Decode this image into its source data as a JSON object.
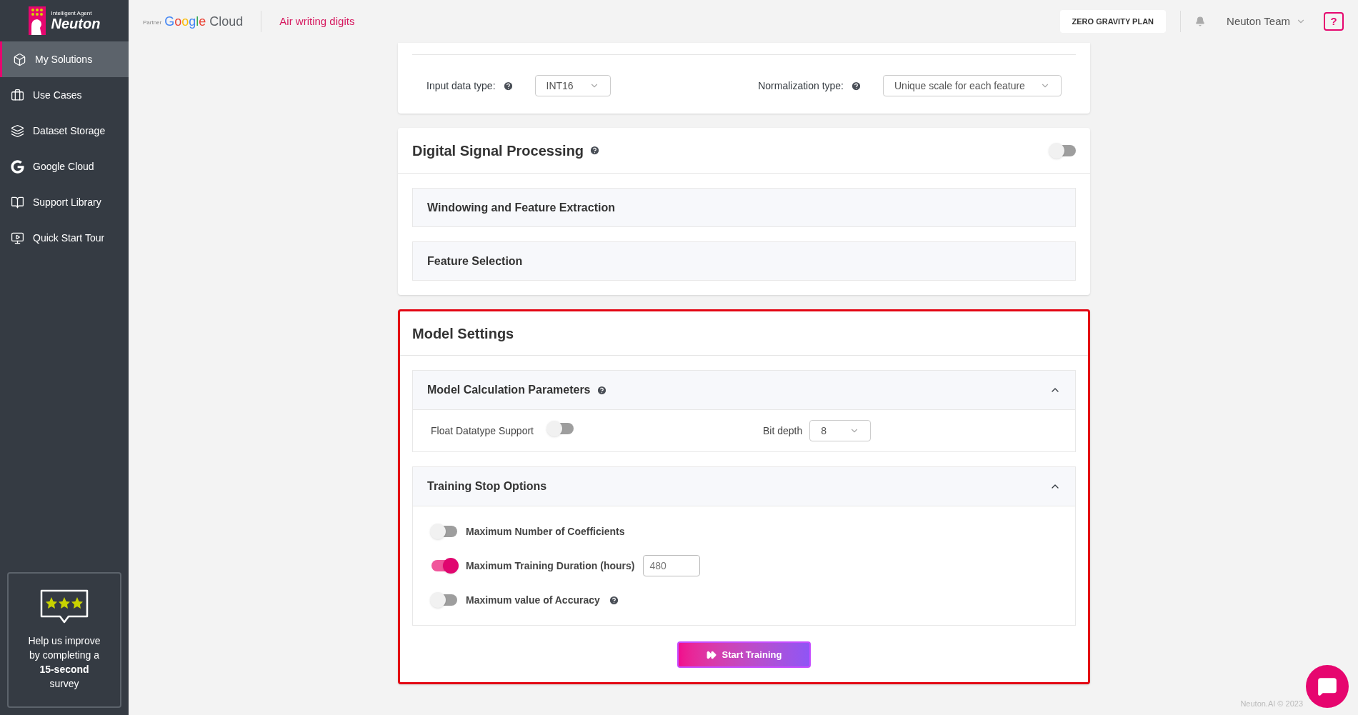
{
  "logo": {
    "tagline": "Intelligent Agent",
    "name": "Neuton"
  },
  "sidebar": {
    "items": [
      {
        "label": "My Solutions",
        "selected": true
      },
      {
        "label": "Use Cases",
        "selected": false
      },
      {
        "label": "Dataset Storage",
        "selected": false
      },
      {
        "label": "Google Cloud",
        "selected": false
      },
      {
        "label": "Support Library",
        "selected": false
      },
      {
        "label": "Quick Start Tour",
        "selected": false
      }
    ],
    "survey": "Help us improve by completing a **15-second** survey"
  },
  "header": {
    "partner": "Partner",
    "brand": "Google",
    "brand_suffix": "Cloud",
    "project": "Air writing digits",
    "plan": "ZERO GRAVITY PLAN",
    "user": "Neuton Team",
    "help": "?"
  },
  "data_settings": {
    "fields": [
      {
        "label": "Input data type:",
        "value": "INT16"
      },
      {
        "label": "Normalization type:",
        "value": "Unique scale for each feature"
      }
    ]
  },
  "dsp": {
    "title": "Digital Signal Processing",
    "on": false,
    "sections": [
      "Windowing and Feature Extraction",
      "Feature Selection"
    ]
  },
  "model_settings": {
    "title": "Model Settings",
    "highlighted": true,
    "calc": {
      "title": "Model Calculation Parameters",
      "expanded": true,
      "float_label": "Float Datatype Support",
      "float_on": false,
      "bit_label": "Bit depth",
      "bit_value": "8"
    },
    "stop": {
      "title": "Training Stop Options",
      "expanded": true,
      "options": [
        {
          "label": "Maximum Number of Coefficients",
          "on": false,
          "help": false
        },
        {
          "label": "Maximum Training Duration (hours)",
          "on": true,
          "value": "480",
          "help": false
        },
        {
          "label": "Maximum value of Accuracy",
          "on": false,
          "help": true
        }
      ]
    },
    "button": "Start Training"
  },
  "footer": "Neuton.AI © 2023"
}
